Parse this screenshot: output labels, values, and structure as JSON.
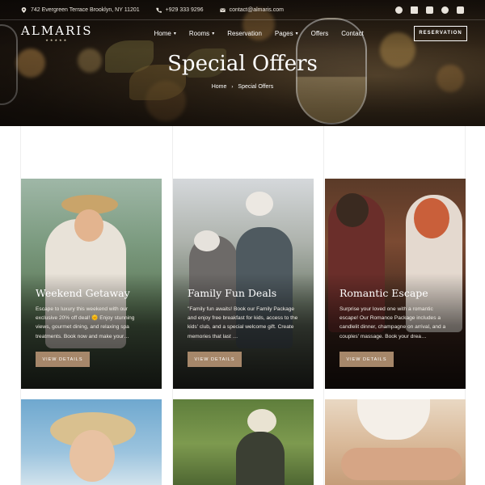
{
  "topbar": {
    "address": "742 Evergreen Terrace Brooklyn, NY 11201",
    "phone": "+929 333 9296",
    "email": "contact@almaris.com"
  },
  "social_icons": [
    "facebook-icon",
    "x-icon",
    "youtube-icon",
    "pinterest-icon",
    "instagram-icon"
  ],
  "brand": {
    "name": "ALMARIS",
    "stars": "★★★★★"
  },
  "nav": {
    "items": [
      {
        "label": "Home",
        "dropdown": true
      },
      {
        "label": "Rooms",
        "dropdown": true
      },
      {
        "label": "Reservation",
        "dropdown": false
      },
      {
        "label": "Pages",
        "dropdown": true
      },
      {
        "label": "Offers",
        "dropdown": false
      },
      {
        "label": "Contact",
        "dropdown": false
      }
    ],
    "reservation_button": "RESERVATION"
  },
  "hero": {
    "title": "Special Offers",
    "breadcrumb": [
      "Home",
      "Special Offers"
    ],
    "separator": "›"
  },
  "offers": [
    {
      "title": "Weekend Getaway",
      "text": "Escape to luxury this weekend with our exclusive 20% off deal! 🌞 Enjoy stunning views, gourmet dining, and relaxing spa treatments. Book now and make your…",
      "button": "VIEW DETAILS"
    },
    {
      "title": "Family Fun Deals",
      "text": "\"Family fun awaits! Book our Family Package and enjoy free breakfast for kids, access to the kids' club, and a special welcome gift. Create memories that last …",
      "button": "VIEW DETAILS"
    },
    {
      "title": "Romantic Escape",
      "text": "Surprise your loved one with a romantic escape! Our Romance Package includes a candlelit dinner, champagne on arrival, and a couples' massage. Book your drea…",
      "button": "VIEW DETAILS"
    }
  ],
  "colors": {
    "accent": "#a6876a",
    "hero_dark": "#1e160f",
    "text_light": "#f1ede6"
  }
}
